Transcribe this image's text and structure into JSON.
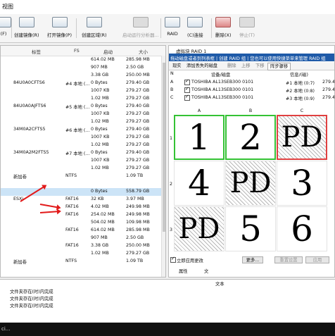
{
  "window": {
    "title_fragment": "视图"
  },
  "toolbar": {
    "buttons": [
      {
        "label": "(F)",
        "enabled": true,
        "icon": "partial-icon"
      },
      {
        "label": "创建镜像(R)",
        "enabled": true,
        "icon": "create-image-icon"
      },
      {
        "label": "打开镜像(P)",
        "enabled": true,
        "icon": "open-image-icon"
      },
      {
        "label": "创建区域(R)",
        "enabled": true,
        "icon": "create-region-icon"
      },
      {
        "label": "启动运行分析器...",
        "enabled": false,
        "icon": "analyzer-icon"
      },
      {
        "label": "RAID",
        "enabled": true,
        "icon": "raid-icon"
      },
      {
        "label": "(C)连接",
        "enabled": true,
        "icon": "connect-icon"
      },
      {
        "label": "删除(X)",
        "enabled": true,
        "icon": "delete-icon"
      },
      {
        "label": "停止(T)",
        "enabled": false,
        "icon": "stop-icon"
      }
    ]
  },
  "left_panel": {
    "columns": [
      "标签",
      "FS",
      "启动",
      "大小"
    ],
    "rows": [
      {
        "name": "",
        "fs": "",
        "start": "614.02 MB",
        "size": "285.98 MB"
      },
      {
        "name": "",
        "fs": "",
        "start": "907 MB",
        "size": "2.50 GB"
      },
      {
        "name": "",
        "fs": "",
        "start": "3.38 GB",
        "size": "250.00 MB"
      },
      {
        "name": "84U0A0CFTS6",
        "fs": "#4 本地 (...",
        "start": "0 Bytes",
        "size": "279.40 GB"
      },
      {
        "name": "",
        "fs": "",
        "start": "1007 KB",
        "size": "279.27 GB"
      },
      {
        "name": "",
        "fs": "",
        "start": "1.02 MB",
        "size": "279.27 GB"
      },
      {
        "name": "84U0A0AJFTS6",
        "fs": "#5 本地 (...",
        "start": "0 Bytes",
        "size": "279.40 GB"
      },
      {
        "name": "",
        "fs": "",
        "start": "1007 KB",
        "size": "279.27 GB"
      },
      {
        "name": "",
        "fs": "",
        "start": "1.02 MB",
        "size": "279.27 GB"
      },
      {
        "name": "34M0A2CFTS5",
        "fs": "#6 本地 (...",
        "start": "0 Bytes",
        "size": "279.40 GB"
      },
      {
        "name": "",
        "fs": "",
        "start": "1007 KB",
        "size": "279.27 GB"
      },
      {
        "name": "",
        "fs": "",
        "start": "1.02 MB",
        "size": "279.27 GB"
      },
      {
        "name": "34M0A2M2FTS5",
        "fs": "#7 本地 (...",
        "start": "0 Bytes",
        "size": "279.40 GB"
      },
      {
        "name": "",
        "fs": "",
        "start": "1007 KB",
        "size": "279.27 GB"
      },
      {
        "name": "",
        "fs": "",
        "start": "1.02 MB",
        "size": "279.27 GB"
      },
      {
        "name": "新加卷",
        "fs": "NTFS",
        "start": "",
        "size": "1.09 TB"
      },
      {
        "name": "",
        "fs": "",
        "start": "",
        "size": ""
      },
      {
        "name": "",
        "fs": "",
        "start": "0 Bytes",
        "size": "558.79 GB"
      },
      {
        "name": "ESXi",
        "fs": "FAT16",
        "start": "32 KB",
        "size": "3.97 MB"
      },
      {
        "name": "",
        "fs": "FAT16",
        "start": "4.02 MB",
        "size": "249.98 MB"
      },
      {
        "name": "",
        "fs": "FAT16",
        "start": "254.02 MB",
        "size": "249.98 MB"
      },
      {
        "name": "",
        "fs": "",
        "start": "504.02 MB",
        "size": "109.98 MB"
      },
      {
        "name": "",
        "fs": "FAT16",
        "start": "614.02 MB",
        "size": "285.98 MB"
      },
      {
        "name": "",
        "fs": "",
        "start": "907 MB",
        "size": "2.50 GB"
      },
      {
        "name": "",
        "fs": "FAT16",
        "start": "3.38 GB",
        "size": "250.00 MB"
      },
      {
        "name": "",
        "fs": "",
        "start": "1.02 MB",
        "size": "279.27 GB"
      },
      {
        "name": "新加卷",
        "fs": "NTFS",
        "start": "",
        "size": "1.09 TB"
      }
    ]
  },
  "right_panel": {
    "title": "虚拟块 RAID 1",
    "info": "拖动磁盘或者到列表框 | 创建 RAID 组 | 您也可以使用快捷菜单来管理 RAID 组",
    "tabs": [
      "现实",
      "添加丢失的磁盘",
      "删除",
      "上移",
      "下移",
      "阵步骤移"
    ],
    "disk_header": {
      "device": "设备/磁盘",
      "info": "信息/(磁)"
    },
    "disks": [
      {
        "letter": "A",
        "device": "TOSHIBA AL13SEB300 0101",
        "info": "#1 本地 (0:7)",
        "size": "279.4"
      },
      {
        "letter": "B",
        "device": "TOSHIBA AL13SEB300 0101",
        "info": "#2 本地 (0:8)",
        "size": "279.4"
      },
      {
        "letter": "C",
        "device": "TOSHIBA AL13SEB300 0101",
        "info": "#3 本地 (0:9)",
        "size": "279.4"
      }
    ],
    "grid": {
      "columns": [
        "A",
        "B",
        "C"
      ],
      "rows": [
        "1",
        "2",
        "3"
      ],
      "cells": [
        "1",
        "2",
        "PD",
        "4",
        "PD",
        "3",
        "PD",
        "5",
        "6"
      ]
    },
    "bottom": {
      "checkbox_label": "立即应用更改",
      "more_label": "更多...",
      "reset_label": "重置设置",
      "apply_label": "应用"
    },
    "footer_tabs": [
      "属性",
      "文"
    ]
  },
  "bottom_log": {
    "header": "文本",
    "lines": [
      "文件夹存在(时)内完成",
      "文件夹存在(时)内完成",
      "文件夹存在(时)内完成"
    ]
  },
  "taskbar": {
    "label": "ci..."
  }
}
